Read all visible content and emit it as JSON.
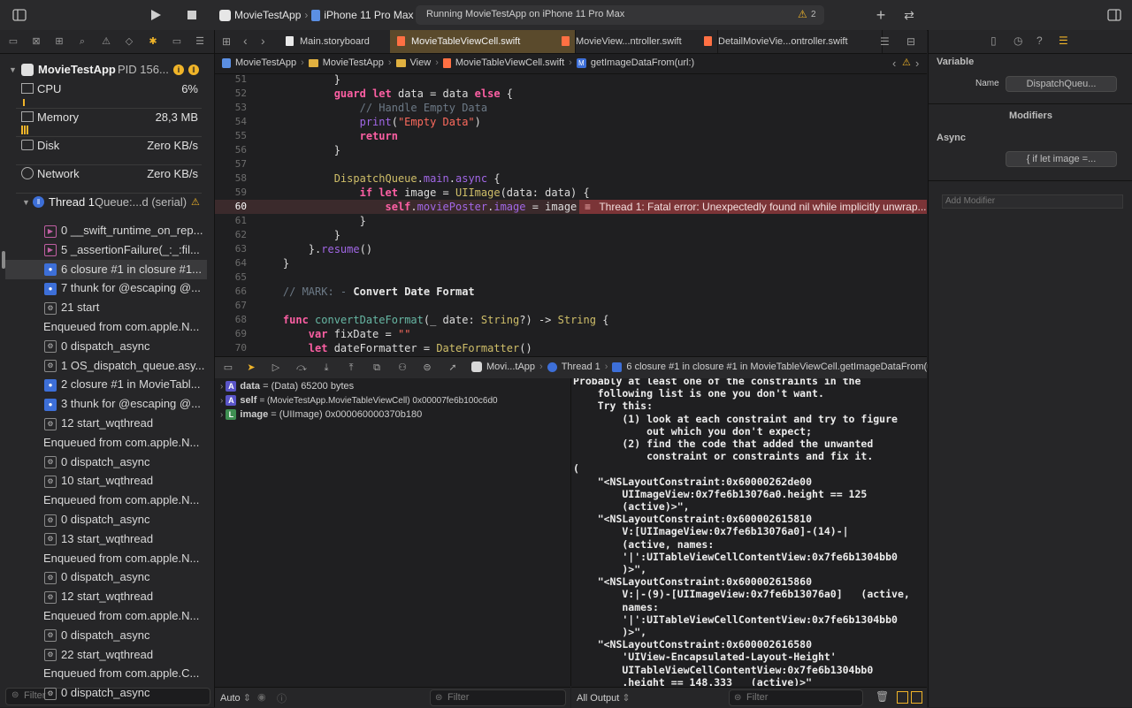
{
  "toolbar": {
    "scheme_name": "MovieTestApp",
    "destination": "iPhone 11 Pro Max",
    "activity_text": "Running MovieTestApp on iPhone 11 Pro Max",
    "warning_count": "2"
  },
  "navigator": {
    "process_name": "MovieTestApp",
    "process_pid": "PID 156...",
    "gauges": [
      {
        "label": "CPU",
        "value": "6%"
      },
      {
        "label": "Memory",
        "value": "28,3 MB"
      },
      {
        "label": "Disk",
        "value": "Zero KB/s"
      },
      {
        "label": "Network",
        "value": "Zero KB/s"
      }
    ],
    "thread_label": "Thread 1",
    "thread_queue": "Queue:...d (serial)",
    "frames": [
      {
        "text": "0 __swift_runtime_on_rep...",
        "icon": "swift-frame-icon"
      },
      {
        "text": "5 _assertionFailure(_:_:fil...",
        "icon": "swift-frame-icon"
      },
      {
        "text": "6 closure #1 in closure #1...",
        "icon": "user-frame-icon",
        "selected": true
      },
      {
        "text": "7 thunk for @escaping @...",
        "icon": "user-frame-icon"
      },
      {
        "text": "21 start",
        "icon": "system-frame-icon"
      },
      {
        "text": "Enqueued from com.apple.N...",
        "icon": "none"
      },
      {
        "text": "0 dispatch_async",
        "icon": "system-frame-icon"
      },
      {
        "text": "1 OS_dispatch_queue.asy...",
        "icon": "system-frame-icon"
      },
      {
        "text": "2 closure #1 in MovieTabl...",
        "icon": "user-frame-icon"
      },
      {
        "text": "3 thunk for @escaping @...",
        "icon": "user-frame-icon"
      },
      {
        "text": "12 start_wqthread",
        "icon": "system-frame-icon"
      },
      {
        "text": "Enqueued from com.apple.N...",
        "icon": "none"
      },
      {
        "text": "0 dispatch_async",
        "icon": "system-frame-icon"
      },
      {
        "text": "10 start_wqthread",
        "icon": "system-frame-icon"
      },
      {
        "text": "Enqueued from com.apple.N...",
        "icon": "none"
      },
      {
        "text": "0 dispatch_async",
        "icon": "system-frame-icon"
      },
      {
        "text": "13 start_wqthread",
        "icon": "system-frame-icon"
      },
      {
        "text": "Enqueued from com.apple.N...",
        "icon": "none"
      },
      {
        "text": "0 dispatch_async",
        "icon": "system-frame-icon"
      },
      {
        "text": "12 start_wqthread",
        "icon": "system-frame-icon"
      },
      {
        "text": "Enqueued from com.apple.N...",
        "icon": "none"
      },
      {
        "text": "0 dispatch_async",
        "icon": "system-frame-icon"
      },
      {
        "text": "22 start_wqthread",
        "icon": "system-frame-icon"
      },
      {
        "text": "Enqueued from com.apple.C...",
        "icon": "none"
      },
      {
        "text": "0 dispatch_async",
        "icon": "system-frame-icon"
      }
    ],
    "filter_placeholder": "Filter"
  },
  "tabs": [
    {
      "label": "Main.storyboard",
      "active": false
    },
    {
      "label": "MovieTableViewCell.swift",
      "active": true
    },
    {
      "label": "MovieView...ntroller.swift",
      "active": false
    },
    {
      "label": "DetailMovieVie...ontroller.swift",
      "active": false
    }
  ],
  "jumpbar": [
    "MovieTestApp",
    "MovieTestApp",
    "View",
    "MovieTableViewCell.swift",
    "getImageDataFrom(url:)"
  ],
  "code": {
    "lines": [
      {
        "n": "51",
        "text": "            }"
      },
      {
        "n": "52",
        "text": "            guard let data = data else {"
      },
      {
        "n": "53",
        "text": "                // Handle Empty Data"
      },
      {
        "n": "54",
        "text": "                print(\"Empty Data\")"
      },
      {
        "n": "55",
        "text": "                return"
      },
      {
        "n": "56",
        "text": "            }"
      },
      {
        "n": "57",
        "text": ""
      },
      {
        "n": "58",
        "text": "            DispatchQueue.main.async {"
      },
      {
        "n": "59",
        "text": "                if let image = UIImage(data: data) {"
      },
      {
        "n": "60",
        "text": "                    self.moviePoster.image = image"
      },
      {
        "n": "61",
        "text": "                }"
      },
      {
        "n": "62",
        "text": "            }"
      },
      {
        "n": "63",
        "text": "        }.resume()"
      },
      {
        "n": "64",
        "text": "    }"
      },
      {
        "n": "65",
        "text": ""
      },
      {
        "n": "66",
        "text": "    // MARK: - Convert Date Format"
      },
      {
        "n": "67",
        "text": ""
      },
      {
        "n": "68",
        "text": "    func convertDateFormat(_ date: String?) -> String {"
      },
      {
        "n": "69",
        "text": "        var fixDate = \"\""
      },
      {
        "n": "70",
        "text": "        let dateFormatter = DateFormatter()"
      }
    ],
    "error_message": "Thread 1: Fatal error: Unexpectedly found nil while implicitly unwrap..."
  },
  "debugbar": {
    "crumbs": [
      "Movi...tApp",
      "Thread 1",
      "6 closure #1 in closure #1 in MovieTableViewCell.getImageDataFrom(url:)"
    ]
  },
  "variables": [
    {
      "badge": "A",
      "name": "data",
      "value": "= (Data) 65200 bytes"
    },
    {
      "badge": "A",
      "name": "self",
      "value": "= (MovieTestApp.MovieTableViewCell) 0x00007fe6b100c6d0"
    },
    {
      "badge": "L",
      "name": "image",
      "value": "= (UIImage) 0x000060000370b180"
    }
  ],
  "console_text": "Probably at least one of the constraints in the\n    following list is one you don't want.\n    Try this:\n        (1) look at each constraint and try to figure\n            out which you don't expect;\n        (2) find the code that added the unwanted\n            constraint or constraints and fix it.\n(\n    \"<NSLayoutConstraint:0x60000262de00\n        UIImageView:0x7fe6b13076a0.height == 125\n        (active)>\",\n    \"<NSLayoutConstraint:0x600002615810\n        V:[UIImageView:0x7fe6b13076a0]-(14)-|\n        (active, names:\n        '|':UITableViewCellContentView:0x7fe6b1304bb0\n        )>\",\n    \"<NSLayoutConstraint:0x600002615860\n        V:|-(9)-[UIImageView:0x7fe6b13076a0]   (active,\n        names:\n        '|':UITableViewCellContentView:0x7fe6b1304bb0\n        )>\",\n    \"<NSLayoutConstraint:0x600002616580\n        'UIView-Encapsulated-Layout-Height'\n        UITableViewCellContentView:0x7fe6b1304bb0\n        .height == 148.333   (active)>\"",
  "vars_bottom": {
    "scope": "Auto",
    "filter_placeholder": "Filter"
  },
  "console_bottom": {
    "output": "All Output",
    "filter_placeholder": "Filter"
  },
  "inspector": {
    "section_variable": "Variable",
    "name_label": "Name",
    "name_value": "DispatchQueu...",
    "section_modifiers": "Modifiers",
    "async_label": "Async",
    "async_value": "{ if let image =...",
    "add_modifier_placeholder": "Add Modifier"
  },
  "colors": {
    "accent_warning": "#f0b429",
    "error_banner": "#7b3437",
    "active_tab": "#5a4a2c",
    "keyword": "#fc5fa3"
  }
}
